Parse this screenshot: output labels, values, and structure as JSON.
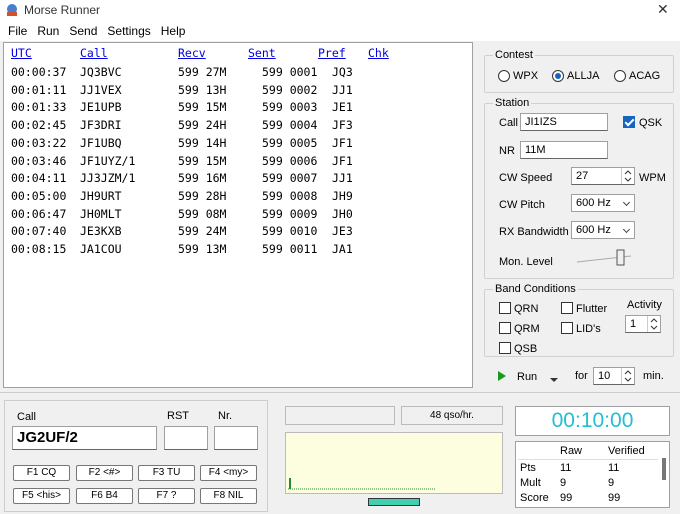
{
  "window": {
    "title": "Morse Runner",
    "close_glyph": "✕"
  },
  "menu": [
    "File",
    "Run",
    "Send",
    "Settings",
    "Help"
  ],
  "log": {
    "headers": {
      "utc": "UTC",
      "call": "Call",
      "recv": "Recv",
      "sent": "Sent",
      "pref": "Pref",
      "chk": "Chk"
    },
    "rows": [
      {
        "utc": "00:00:37",
        "call": "JQ3BVC",
        "recv": "599 27M",
        "sent": "599 0001",
        "pref": "JQ3"
      },
      {
        "utc": "00:01:11",
        "call": "JJ1VEX",
        "recv": "599 13H",
        "sent": "599 0002",
        "pref": "JJ1"
      },
      {
        "utc": "00:01:33",
        "call": "JE1UPB",
        "recv": "599 15M",
        "sent": "599 0003",
        "pref": "JE1"
      },
      {
        "utc": "00:02:45",
        "call": "JF3DRI",
        "recv": "599 24H",
        "sent": "599 0004",
        "pref": "JF3"
      },
      {
        "utc": "00:03:22",
        "call": "JF1UBQ",
        "recv": "599 14H",
        "sent": "599 0005",
        "pref": "JF1"
      },
      {
        "utc": "00:03:46",
        "call": "JF1UYZ/1",
        "recv": "599 15M",
        "sent": "599 0006",
        "pref": "JF1"
      },
      {
        "utc": "00:04:11",
        "call": "JJ3JZM/1",
        "recv": "599 16M",
        "sent": "599 0007",
        "pref": "JJ1"
      },
      {
        "utc": "00:05:00",
        "call": "JH9URT",
        "recv": "599 28H",
        "sent": "599 0008",
        "pref": "JH9"
      },
      {
        "utc": "00:06:47",
        "call": "JH0MLT",
        "recv": "599 08M",
        "sent": "599 0009",
        "pref": "JH0"
      },
      {
        "utc": "00:07:40",
        "call": "JE3KXB",
        "recv": "599 24M",
        "sent": "599 0010",
        "pref": "JE3"
      },
      {
        "utc": "00:08:15",
        "call": "JA1COU",
        "recv": "599 13M",
        "sent": "599 0011",
        "pref": "JA1"
      }
    ]
  },
  "contest": {
    "title": "Contest",
    "options": [
      "WPX",
      "ALLJA",
      "ACAG"
    ],
    "selected": "ALLJA"
  },
  "station": {
    "title": "Station",
    "call_label": "Call",
    "call_value": "JI1IZS",
    "qsk_label": "QSK",
    "qsk_checked": true,
    "nr_label": "NR",
    "nr_value": "11M",
    "cw_speed_label": "CW Speed",
    "cw_speed_value": "27",
    "wpm_label": "WPM",
    "cw_pitch_label": "CW Pitch",
    "cw_pitch_value": "600 Hz",
    "rx_bandwidth_label": "RX Bandwidth",
    "rx_bandwidth_value": "600 Hz",
    "mon_level_label": "Mon. Level"
  },
  "band": {
    "title": "Band Conditions",
    "qrn": "QRN",
    "qrm": "QRM",
    "qsb": "QSB",
    "flutter": "Flutter",
    "lids": "LID's",
    "activity_label": "Activity",
    "activity_value": "1"
  },
  "run": {
    "label": "Run",
    "for_label": "for",
    "minutes_value": "10",
    "min_label": "min."
  },
  "entry": {
    "call_label": "Call",
    "rst_label": "RST",
    "nr_label": "Nr.",
    "call_value": "JG2UF/2",
    "rst_value": "",
    "nr_value": "",
    "fkeys": [
      "F1 CQ",
      "F2 <#>",
      "F3 TU",
      "F4 <my>",
      "F5 <his>",
      "F6 B4",
      "F7 ?",
      "F8 NIL"
    ]
  },
  "status": {
    "rate": "48 qso/hr.",
    "timer": "00:10:00"
  },
  "score": {
    "col_raw": "Raw",
    "col_verified": "Verified",
    "rows": [
      {
        "label": "Pts",
        "raw": "11",
        "verified": "11"
      },
      {
        "label": "Mult",
        "raw": "9",
        "verified": "9"
      },
      {
        "label": "Score",
        "raw": "99",
        "verified": "99"
      }
    ]
  },
  "colors": {
    "accent": "#1565c0",
    "timer": "#20c0d0",
    "header_link": "#0000e0",
    "scope_bg": "#fdfde0"
  }
}
